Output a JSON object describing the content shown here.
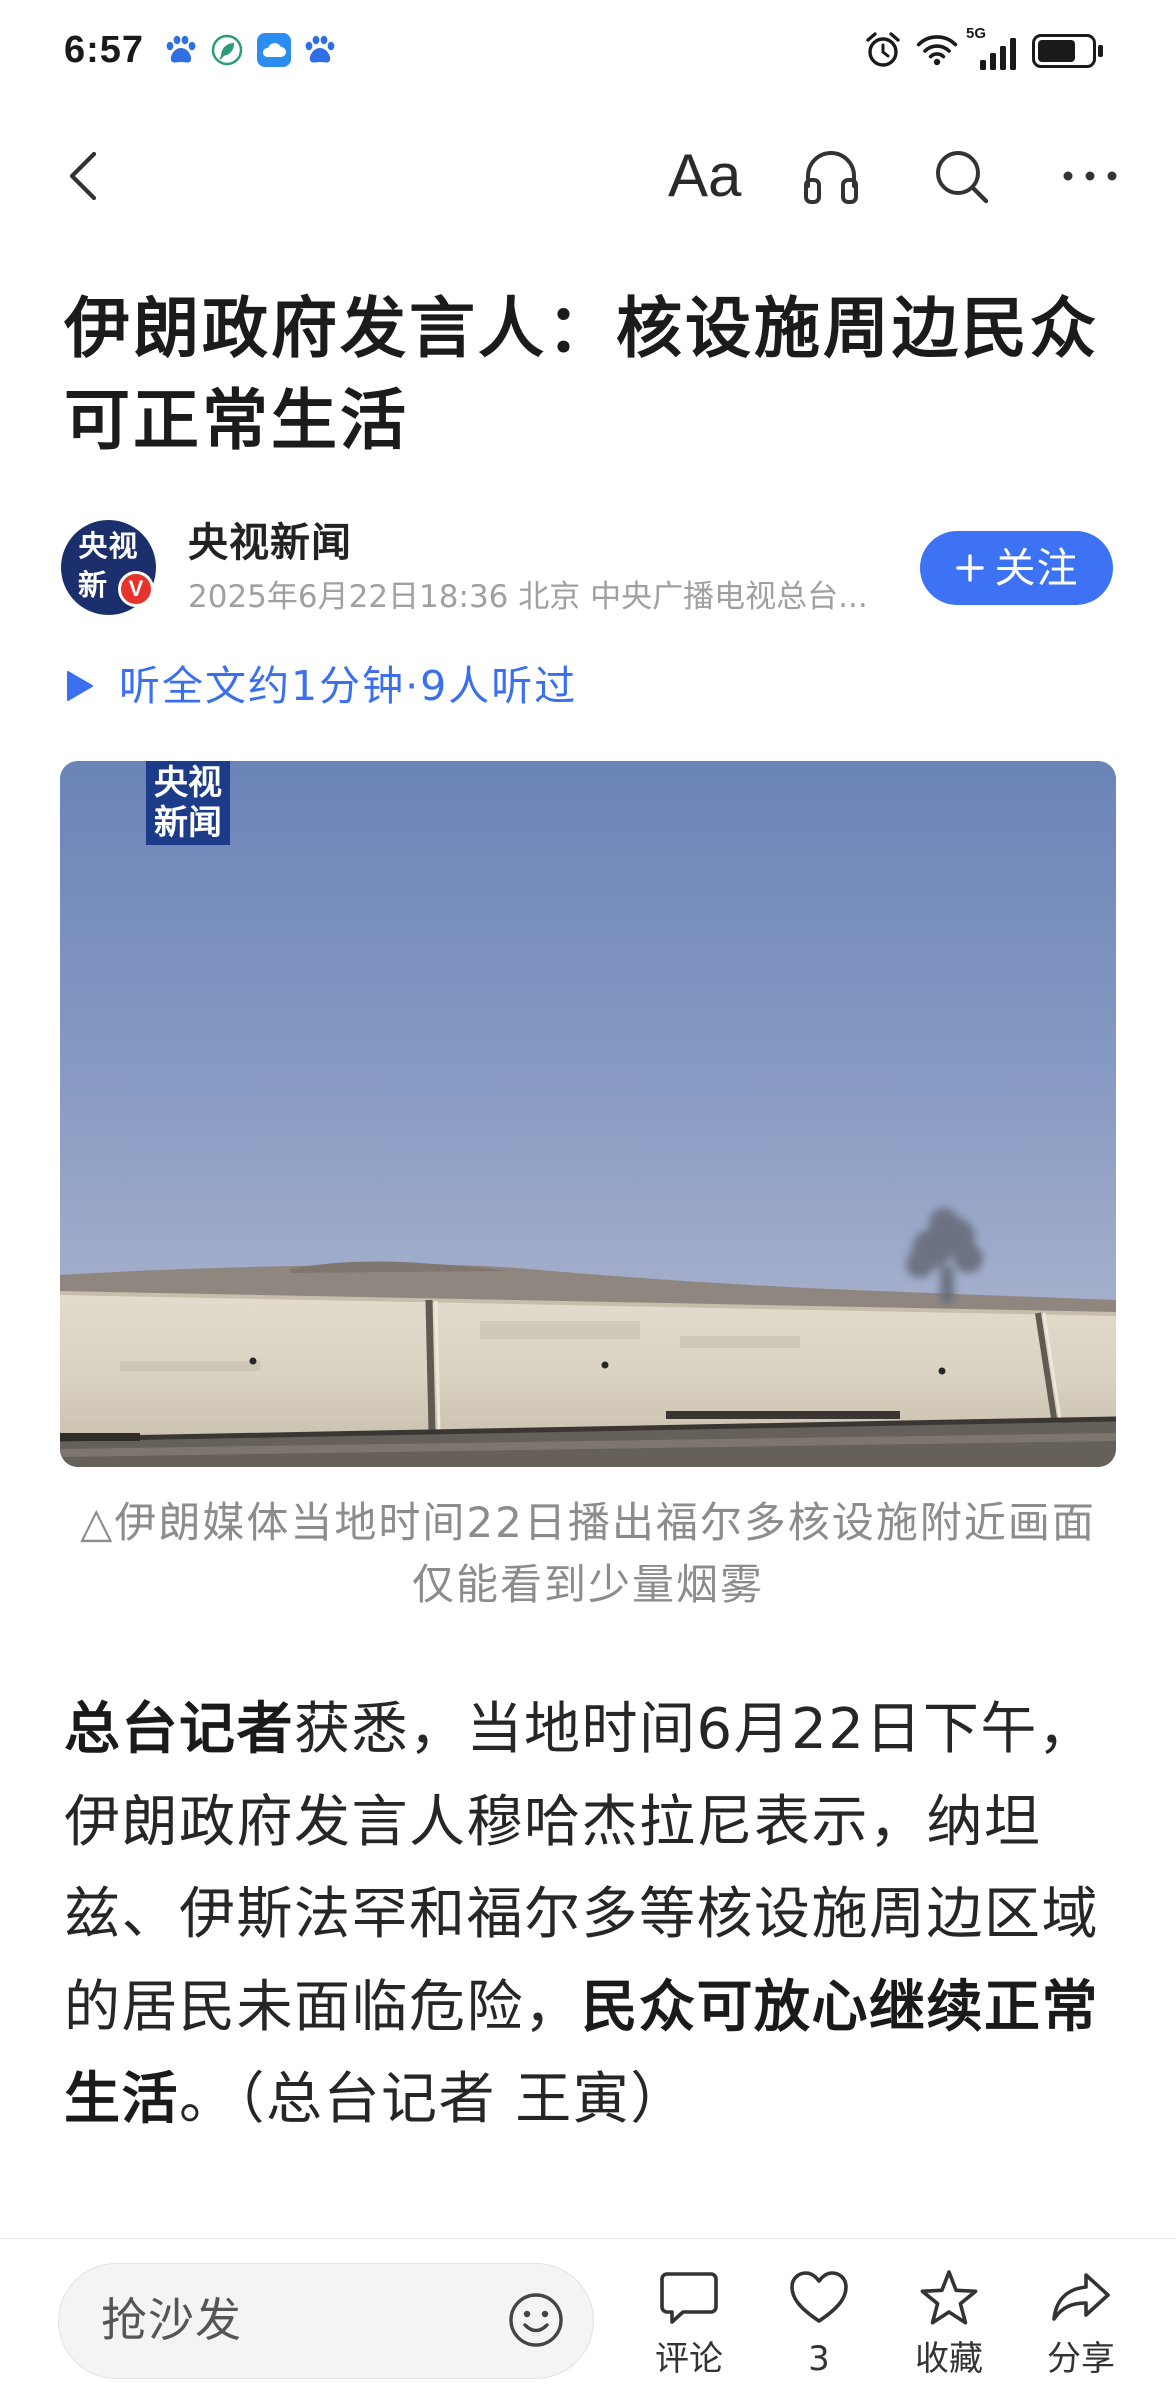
{
  "status_bar": {
    "time": "6:57",
    "notification_icons": [
      "baidu-paw-icon",
      "leaf-icon",
      "cloud-icon",
      "baidu-paw-icon"
    ],
    "system_icons": [
      "alarm-icon",
      "wifi-icon",
      "signal-icon",
      "battery-icon"
    ],
    "network_label": "5G",
    "battery_level": 0.72
  },
  "toolbar": {
    "font_size_label": "Aa",
    "icons": [
      "back-icon",
      "headphones-icon",
      "search-icon",
      "more-icon"
    ]
  },
  "article": {
    "title": "伊朗政府发言人：核设施周边民众可正常生活",
    "author": {
      "name": "央视新闻",
      "meta": "2025年6月22日18:36 北京 中央广播电视总台...",
      "avatar_top": "央视",
      "avatar_bottom": "新",
      "verified_badge": "V",
      "follow_label": "关注",
      "follow_icon": "plus-icon"
    },
    "listen_label": "听全文约1分钟·9人听过",
    "listen_icon": "play-icon",
    "image": {
      "watermark_top": "央视",
      "watermark_bottom": "新闻"
    },
    "caption": "△伊朗媒体当地时间22日播出福尔多核设施附近画面仅能看到少量烟雾",
    "body": [
      {
        "text": "总台记者",
        "bold": true
      },
      {
        "text": "获悉，当地时间6月22日下午，伊朗政府发言人穆哈杰拉尼表示，纳坦兹、伊斯法罕和福尔多等核设施周边区域的居民未面临危险，",
        "bold": false
      },
      {
        "text": "民众可放心继续正常生活",
        "bold": true
      },
      {
        "text": "。（总台记者 王寅）",
        "bold": false
      }
    ]
  },
  "bottom_bar": {
    "comment_placeholder": "抢沙发",
    "comment_label": "评论",
    "like_count": "3",
    "favorite_label": "收藏",
    "share_label": "分享",
    "icons": [
      "smiley-icon",
      "comment-icon",
      "heart-icon",
      "star-icon",
      "share-icon"
    ]
  },
  "colors": {
    "accent": "#3c72f3",
    "text": "#262626",
    "muted": "#8c8c8c",
    "badge_red": "#e8322c"
  }
}
